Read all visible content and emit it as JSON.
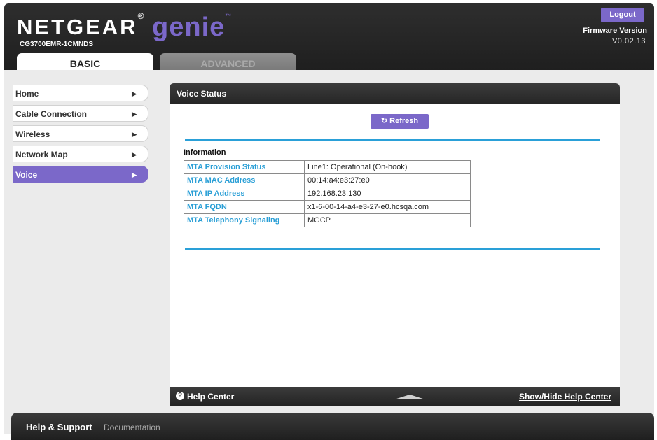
{
  "header": {
    "brand": "NETGEAR",
    "brand_mark": "®",
    "genie": "genie",
    "genie_mark": "™",
    "model": "CG3700EMR-1CMNDS",
    "logout_label": "Logout",
    "firmware_label": "Firmware Version",
    "firmware_version": "V0.02.13"
  },
  "tabs": {
    "basic": "BASIC",
    "advanced": "ADVANCED"
  },
  "sidebar": {
    "items": [
      {
        "label": "Home"
      },
      {
        "label": "Cable Connection"
      },
      {
        "label": "Wireless"
      },
      {
        "label": "Network Map"
      },
      {
        "label": "Voice"
      }
    ],
    "active": "Voice"
  },
  "main": {
    "title": "Voice Status",
    "refresh_label": "Refresh",
    "info_title": "Information",
    "rows": [
      {
        "key": "MTA Provision Status",
        "value": "Line1: Operational (On-hook)"
      },
      {
        "key": "MTA MAC Address",
        "value": "00:14:a4:e3:27:e0"
      },
      {
        "key": "MTA IP Address",
        "value": "192.168.23.130"
      },
      {
        "key": "MTA FQDN",
        "value": "x1-6-00-14-a4-e3-27-e0.hcsqa.com"
      },
      {
        "key": "MTA Telephony Signaling",
        "value": "MGCP"
      }
    ]
  },
  "help": {
    "label": "Help Center",
    "toggle": "Show/Hide Help Center"
  },
  "footer": {
    "title": "Help & Support",
    "link": "Documentation"
  },
  "colors": {
    "accent": "#7b68c9",
    "link_blue": "#2a9fd6",
    "header_dark": "#2b2b2b"
  }
}
